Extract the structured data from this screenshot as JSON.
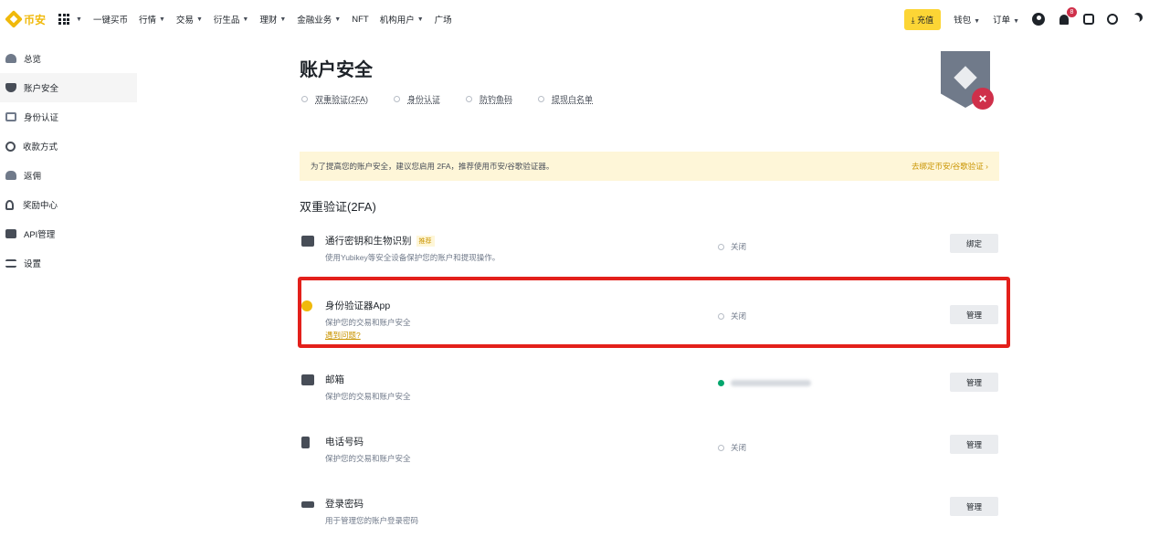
{
  "topbar": {
    "logo_text": "币安",
    "nav": [
      {
        "label": "一键买币",
        "dropdown": false
      },
      {
        "label": "行情",
        "dropdown": true
      },
      {
        "label": "交易",
        "dropdown": true
      },
      {
        "label": "衍生品",
        "dropdown": true
      },
      {
        "label": "理财",
        "dropdown": true
      },
      {
        "label": "金融业务",
        "dropdown": true
      },
      {
        "label": "NFT",
        "dropdown": false
      },
      {
        "label": "机构用户",
        "dropdown": true
      },
      {
        "label": "广场",
        "dropdown": false
      }
    ],
    "deposit_label": "充值",
    "wallet_label": "钱包",
    "orders_label": "订单",
    "notification_count": "8"
  },
  "sidebar": {
    "items": [
      {
        "label": "总览",
        "icon": "person-icon"
      },
      {
        "label": "账户安全",
        "icon": "shield-icon",
        "active": true
      },
      {
        "label": "身份认证",
        "icon": "id-card-icon"
      },
      {
        "label": "收款方式",
        "icon": "coin-icon"
      },
      {
        "label": "返佣",
        "icon": "invite-icon"
      },
      {
        "label": "奖励中心",
        "icon": "reward-icon"
      },
      {
        "label": "API管理",
        "icon": "api-icon"
      },
      {
        "label": "设置",
        "icon": "settings-icon"
      }
    ]
  },
  "main": {
    "title": "账户安全",
    "steps": [
      "双重验证(2FA)",
      "身份认证",
      "防钓鱼码",
      "提现白名单"
    ],
    "banner": {
      "text": "为了提高您的账户安全，建议您启用 2FA，推荐使用币安/谷歌验证器。",
      "link": "去绑定币安/谷歌验证 ›"
    },
    "section_title": "双重验证(2FA)",
    "rows": [
      {
        "title": "通行密钥和生物识别",
        "badge": "推荐",
        "desc": "使用Yubikey等安全设备保护您的账户和提现操作。",
        "status": "关闭",
        "button": "绑定"
      },
      {
        "title": "身份验证器App",
        "desc": "保护您的交易和账户安全",
        "link": "遇到问题?",
        "status": "关闭",
        "button": "管理"
      },
      {
        "title": "邮箱",
        "desc": "保护您的交易和账户安全",
        "status": "",
        "button": "管理"
      },
      {
        "title": "电话号码",
        "desc": "保护您的交易和账户安全",
        "status": "关闭",
        "button": "管理"
      },
      {
        "title": "登录密码",
        "desc": "用于管理您的账户登录密码",
        "status": "",
        "button": "管理"
      }
    ]
  },
  "colors": {
    "accent": "#f0b90b",
    "highlight": "#e3201b",
    "status_on": "#03a66d"
  }
}
